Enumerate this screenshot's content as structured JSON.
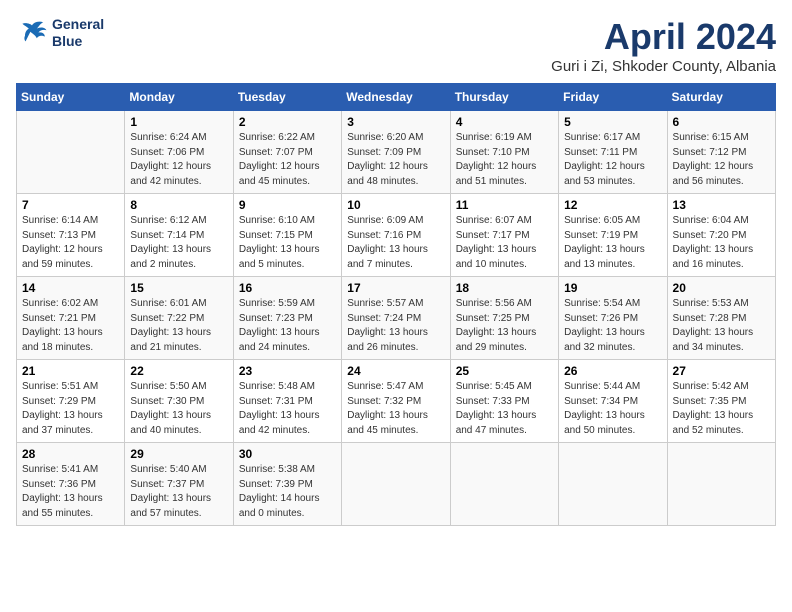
{
  "header": {
    "logo_line1": "General",
    "logo_line2": "Blue",
    "title": "April 2024",
    "subtitle": "Guri i Zi, Shkoder County, Albania"
  },
  "days_of_week": [
    "Sunday",
    "Monday",
    "Tuesday",
    "Wednesday",
    "Thursday",
    "Friday",
    "Saturday"
  ],
  "weeks": [
    [
      {
        "day": "",
        "info": ""
      },
      {
        "day": "1",
        "info": "Sunrise: 6:24 AM\nSunset: 7:06 PM\nDaylight: 12 hours\nand 42 minutes."
      },
      {
        "day": "2",
        "info": "Sunrise: 6:22 AM\nSunset: 7:07 PM\nDaylight: 12 hours\nand 45 minutes."
      },
      {
        "day": "3",
        "info": "Sunrise: 6:20 AM\nSunset: 7:09 PM\nDaylight: 12 hours\nand 48 minutes."
      },
      {
        "day": "4",
        "info": "Sunrise: 6:19 AM\nSunset: 7:10 PM\nDaylight: 12 hours\nand 51 minutes."
      },
      {
        "day": "5",
        "info": "Sunrise: 6:17 AM\nSunset: 7:11 PM\nDaylight: 12 hours\nand 53 minutes."
      },
      {
        "day": "6",
        "info": "Sunrise: 6:15 AM\nSunset: 7:12 PM\nDaylight: 12 hours\nand 56 minutes."
      }
    ],
    [
      {
        "day": "7",
        "info": "Sunrise: 6:14 AM\nSunset: 7:13 PM\nDaylight: 12 hours\nand 59 minutes."
      },
      {
        "day": "8",
        "info": "Sunrise: 6:12 AM\nSunset: 7:14 PM\nDaylight: 13 hours\nand 2 minutes."
      },
      {
        "day": "9",
        "info": "Sunrise: 6:10 AM\nSunset: 7:15 PM\nDaylight: 13 hours\nand 5 minutes."
      },
      {
        "day": "10",
        "info": "Sunrise: 6:09 AM\nSunset: 7:16 PM\nDaylight: 13 hours\nand 7 minutes."
      },
      {
        "day": "11",
        "info": "Sunrise: 6:07 AM\nSunset: 7:17 PM\nDaylight: 13 hours\nand 10 minutes."
      },
      {
        "day": "12",
        "info": "Sunrise: 6:05 AM\nSunset: 7:19 PM\nDaylight: 13 hours\nand 13 minutes."
      },
      {
        "day": "13",
        "info": "Sunrise: 6:04 AM\nSunset: 7:20 PM\nDaylight: 13 hours\nand 16 minutes."
      }
    ],
    [
      {
        "day": "14",
        "info": "Sunrise: 6:02 AM\nSunset: 7:21 PM\nDaylight: 13 hours\nand 18 minutes."
      },
      {
        "day": "15",
        "info": "Sunrise: 6:01 AM\nSunset: 7:22 PM\nDaylight: 13 hours\nand 21 minutes."
      },
      {
        "day": "16",
        "info": "Sunrise: 5:59 AM\nSunset: 7:23 PM\nDaylight: 13 hours\nand 24 minutes."
      },
      {
        "day": "17",
        "info": "Sunrise: 5:57 AM\nSunset: 7:24 PM\nDaylight: 13 hours\nand 26 minutes."
      },
      {
        "day": "18",
        "info": "Sunrise: 5:56 AM\nSunset: 7:25 PM\nDaylight: 13 hours\nand 29 minutes."
      },
      {
        "day": "19",
        "info": "Sunrise: 5:54 AM\nSunset: 7:26 PM\nDaylight: 13 hours\nand 32 minutes."
      },
      {
        "day": "20",
        "info": "Sunrise: 5:53 AM\nSunset: 7:28 PM\nDaylight: 13 hours\nand 34 minutes."
      }
    ],
    [
      {
        "day": "21",
        "info": "Sunrise: 5:51 AM\nSunset: 7:29 PM\nDaylight: 13 hours\nand 37 minutes."
      },
      {
        "day": "22",
        "info": "Sunrise: 5:50 AM\nSunset: 7:30 PM\nDaylight: 13 hours\nand 40 minutes."
      },
      {
        "day": "23",
        "info": "Sunrise: 5:48 AM\nSunset: 7:31 PM\nDaylight: 13 hours\nand 42 minutes."
      },
      {
        "day": "24",
        "info": "Sunrise: 5:47 AM\nSunset: 7:32 PM\nDaylight: 13 hours\nand 45 minutes."
      },
      {
        "day": "25",
        "info": "Sunrise: 5:45 AM\nSunset: 7:33 PM\nDaylight: 13 hours\nand 47 minutes."
      },
      {
        "day": "26",
        "info": "Sunrise: 5:44 AM\nSunset: 7:34 PM\nDaylight: 13 hours\nand 50 minutes."
      },
      {
        "day": "27",
        "info": "Sunrise: 5:42 AM\nSunset: 7:35 PM\nDaylight: 13 hours\nand 52 minutes."
      }
    ],
    [
      {
        "day": "28",
        "info": "Sunrise: 5:41 AM\nSunset: 7:36 PM\nDaylight: 13 hours\nand 55 minutes."
      },
      {
        "day": "29",
        "info": "Sunrise: 5:40 AM\nSunset: 7:37 PM\nDaylight: 13 hours\nand 57 minutes."
      },
      {
        "day": "30",
        "info": "Sunrise: 5:38 AM\nSunset: 7:39 PM\nDaylight: 14 hours\nand 0 minutes."
      },
      {
        "day": "",
        "info": ""
      },
      {
        "day": "",
        "info": ""
      },
      {
        "day": "",
        "info": ""
      },
      {
        "day": "",
        "info": ""
      }
    ]
  ]
}
